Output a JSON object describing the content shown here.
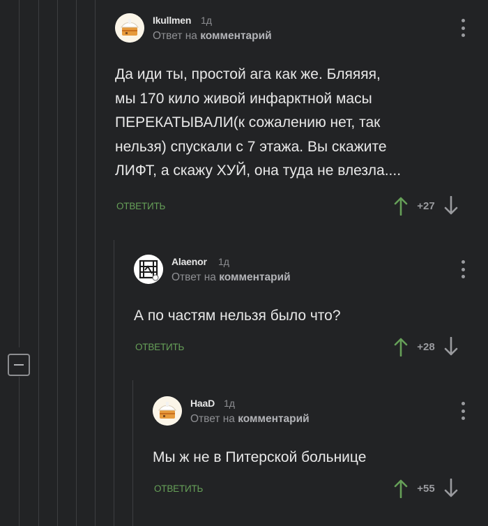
{
  "comments": [
    {
      "username": "Ikullmen",
      "time": "1д",
      "reply_prefix": "Ответ на",
      "reply_link": "комментарий",
      "lines": [
        "Да иди ты, простой ага как же. Бляяяя,",
        "мы 170 кило живой инфарктной масы",
        "ПЕРЕКАТЫВАЛИ(к сожалению нет, так",
        "нельзя) спускали с 7 этажа. Вы скажите",
        "ЛИФТ, а скажу ХУЙ, она туда не влезла...."
      ],
      "reply_label": "ответить",
      "rating": "+27",
      "avatar_icon": "cake-avatar"
    },
    {
      "username": "Alaenor",
      "time": "1д",
      "reply_prefix": "Ответ на",
      "reply_link": "комментарий",
      "lines": [
        "А по частям нельзя было что?"
      ],
      "reply_label": "ответить",
      "rating": "+28",
      "avatar_icon": "rammstein-logo-avatar"
    },
    {
      "username": "HaaD",
      "time": "1д",
      "reply_prefix": "Ответ на",
      "reply_link": "комментарий",
      "lines": [
        "Мы ж не в Питерской больнице"
      ],
      "reply_label": "ответить",
      "rating": "+55",
      "avatar_icon": "cake-avatar"
    }
  ],
  "colors": {
    "background": "#222325",
    "reply_button": "#66a058",
    "upvote_arrow": "#66a058",
    "downvote_arrow": "#9a9b9f"
  },
  "icons": {
    "collapse": "minus-icon",
    "more": "more-vertical-icon",
    "upvote": "arrow-up-icon",
    "downvote": "arrow-down-icon"
  }
}
